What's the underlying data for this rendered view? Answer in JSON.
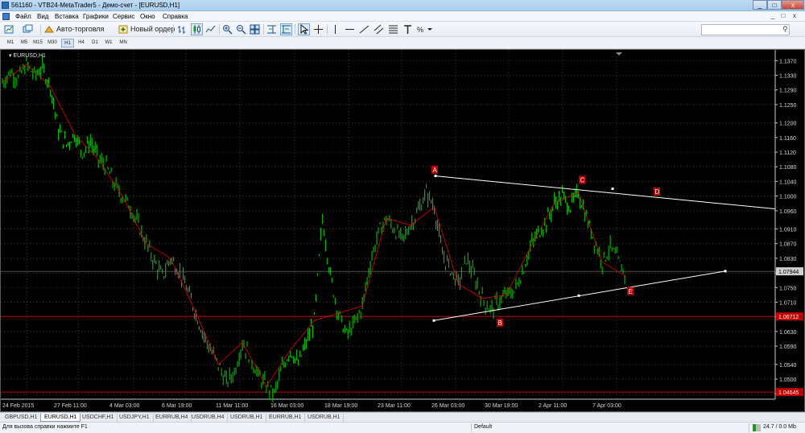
{
  "window": {
    "title": "561160 - VTB24-MetaTrader5 - Демо-счет - [EURUSD,H1]",
    "buttons": [
      "_",
      "□",
      "x"
    ]
  },
  "menu": {
    "items": [
      "Файл",
      "Вид",
      "Вставка",
      "Графики",
      "Сервис",
      "Окно",
      "Справка"
    ],
    "mdi_buttons": [
      "_",
      "□",
      "x"
    ]
  },
  "toolbar": {
    "autotrading_label": "Авто-торговля",
    "neworder_label": "Новый ордер",
    "search_placeholder": ""
  },
  "timeframes": {
    "items": [
      "M1",
      "M5",
      "M15",
      "M30",
      "H1",
      "H4",
      "D1",
      "W1",
      "MN"
    ],
    "active": "H1"
  },
  "chart": {
    "symbol_label": "EURUSD,H1",
    "background": "#000000",
    "bull_color": "#00c000",
    "bear_color": "#00c000",
    "zigzag_color": "#ff0000",
    "grid": true,
    "bid_line_label": "1.07944",
    "red_level_label": "1.06712",
    "bottom_red_label": "1.04645",
    "wave_labels": [
      "A",
      "C",
      "B",
      "D",
      "E"
    ]
  },
  "chart_data": {
    "type": "line",
    "title": "EURUSD,H1",
    "xlabel": "",
    "ylabel": "",
    "ylim": [
      1.0445,
      1.1395
    ],
    "y_ticks": [
      "1.1370",
      "1.1330",
      "1.1290",
      "1.1250",
      "1.1200",
      "1.1160",
      "1.1120",
      "1.1080",
      "1.1040",
      "1.1000",
      "1.0960",
      "1.0910",
      "1.0870",
      "1.0830",
      "1.0790",
      "1.0750",
      "1.0710",
      "1.0670",
      "1.0630",
      "1.0590",
      "1.0540",
      "1.0500",
      "1.0460"
    ],
    "x_ticks": [
      "24 Feb 2015",
      "27 Feb 11:00",
      "4 Mar 03:00",
      "6 Mar 19:00",
      "11 Mar 11:00",
      "16 Mar 03:00",
      "18 Mar 19:00",
      "23 Mar 11:00",
      "26 Mar 03:00",
      "30 Mar 19:00",
      "2 Apr 11:00",
      "7 Apr 03:00"
    ],
    "price_path": [
      1.131,
      1.134,
      1.132,
      1.136,
      1.133,
      1.135,
      1.13,
      1.118,
      1.114,
      1.117,
      1.112,
      1.115,
      1.11,
      1.108,
      1.103,
      1.1,
      1.097,
      1.092,
      1.087,
      1.082,
      1.078,
      1.083,
      1.08,
      1.075,
      1.069,
      1.063,
      1.058,
      1.054,
      1.049,
      1.052,
      1.06,
      1.056,
      1.051,
      1.048,
      1.046,
      1.053,
      1.058,
      1.054,
      1.06,
      1.066,
      1.094,
      1.078,
      1.068,
      1.062,
      1.065,
      1.07,
      1.082,
      1.09,
      1.094,
      1.091,
      1.088,
      1.092,
      1.096,
      1.101,
      1.097,
      1.084,
      1.08,
      1.076,
      1.083,
      1.078,
      1.072,
      1.069,
      1.071,
      1.073,
      1.074,
      1.079,
      1.086,
      1.09,
      1.093,
      1.098,
      1.1,
      1.097,
      1.101,
      1.094,
      1.088,
      1.082,
      1.086,
      1.082,
      1.078
    ],
    "trendlines": [
      {
        "name": "upper",
        "from": {
          "x": "26 Mar 03:00",
          "y": 1.1055
        },
        "to": {
          "x": "end",
          "y": 1.0965
        }
      },
      {
        "name": "lower",
        "from": {
          "x": "26 Mar 03:00",
          "y": 1.066
        },
        "to": {
          "x": "9 Apr",
          "y": 1.0795
        }
      }
    ],
    "levels": [
      {
        "name": "bid",
        "y": 1.07944
      },
      {
        "name": "red",
        "y": 1.06712
      },
      {
        "name": "bottom",
        "y": 1.04645
      }
    ]
  },
  "tabs": {
    "items": [
      "GBPUSD,H1",
      "EURUSD,H1",
      "USDCHF,H1",
      "USDJPY,H1",
      "EURRUB,H4",
      "USDRUB,H4",
      "USDRUB,H1",
      "EURRUB,H1",
      "USDRUB,H1"
    ],
    "active": "EURUSD,H1"
  },
  "status": {
    "help_text": "Для вызова справки нажмите F1",
    "profile": "Default",
    "connection": "24.7 / 0.0 Mb"
  }
}
